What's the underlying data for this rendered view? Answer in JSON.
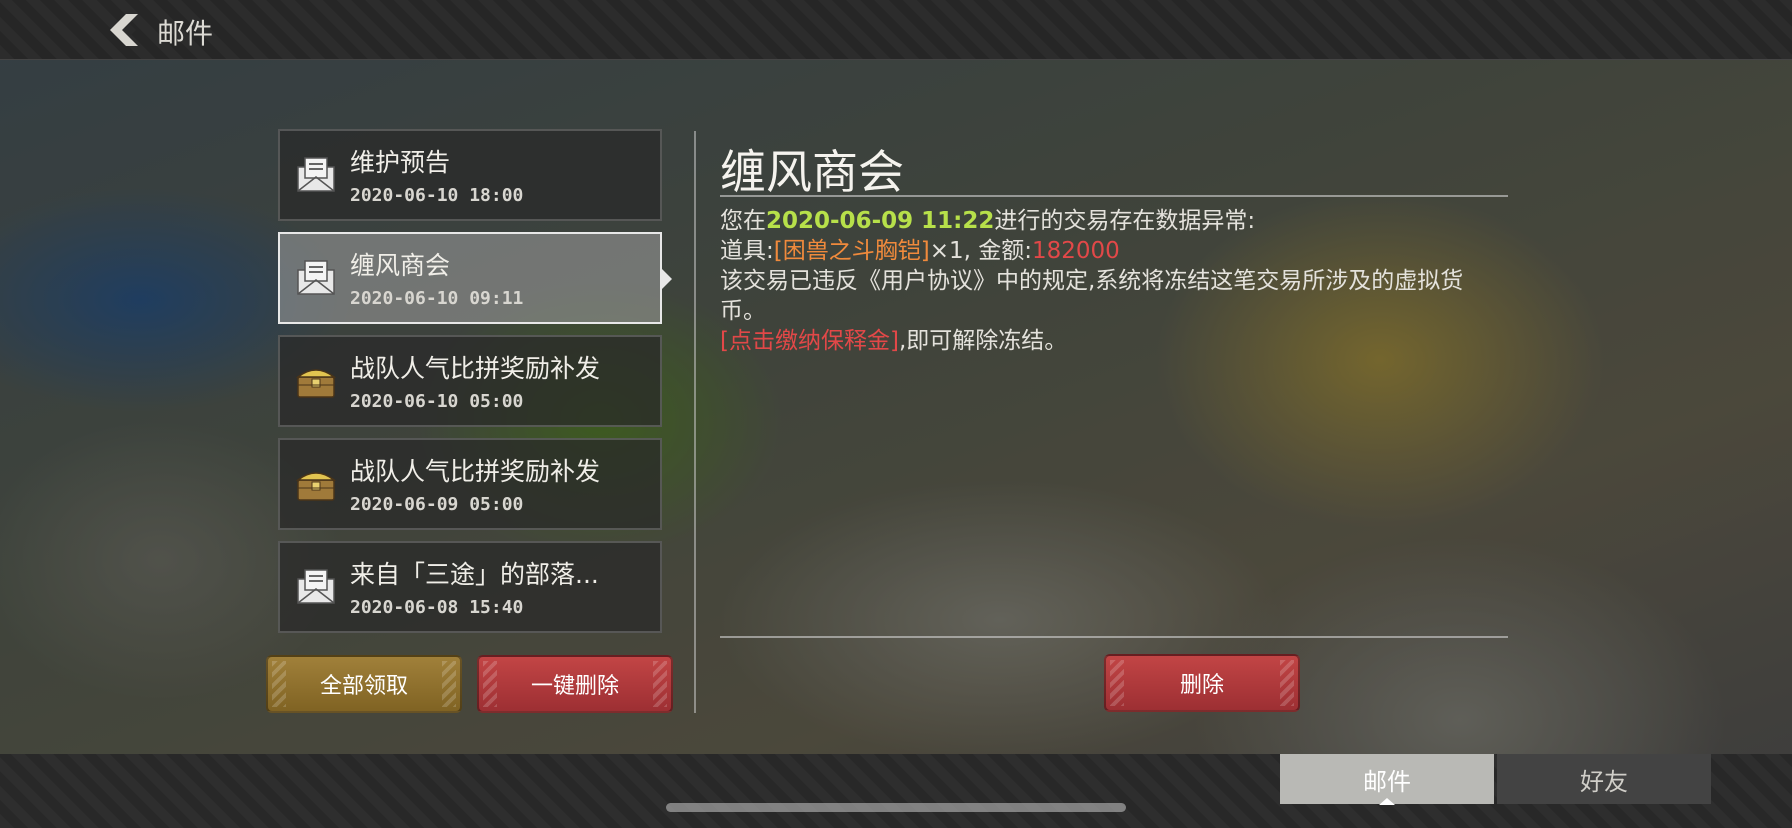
{
  "header": {
    "title": "邮件",
    "back_icon": "back-chevron-icon"
  },
  "mails": [
    {
      "title": "维护预告",
      "time": "2020-06-10  18:00",
      "icon": "envelope-icon",
      "selected": false
    },
    {
      "title": "缠风商会",
      "time": "2020-06-10  09:11",
      "icon": "envelope-icon",
      "selected": true
    },
    {
      "title": "战队人气比拼奖励补发",
      "time": "2020-06-10  05:00",
      "icon": "treasure-chest-icon",
      "selected": false
    },
    {
      "title": "战队人气比拼奖励补发",
      "time": "2020-06-09  05:00",
      "icon": "treasure-chest-icon",
      "selected": false
    },
    {
      "title": "来自「三途」的部落...",
      "time": "2020-06-08  15:40",
      "icon": "envelope-icon",
      "selected": false
    }
  ],
  "list_actions": {
    "claim_all": "全部领取",
    "delete_all": "一键删除"
  },
  "detail": {
    "title": "缠风商会",
    "line1_pre": "您在",
    "line1_time": "2020-06-09  11:22",
    "line1_post": "进行的交易存在数据异常:",
    "line2_label": "道具:",
    "line2_item": "[困兽之斗胸铠]",
    "line2_qty": "×1, 金额:",
    "line2_amount": "182000",
    "line3": "该交易已违反《用户协议》中的规定,系统将冻结这笔交易所涉及的虚拟货币。",
    "line4_link": "[点击缴纳保释金]",
    "line4_post": ",即可解除冻结。",
    "delete_label": "删除"
  },
  "tabs": {
    "mail": "邮件",
    "friends": "好友"
  },
  "colors": {
    "highlight_green": "#b7e04a",
    "highlight_orange": "#f08a3c",
    "highlight_red": "#e24848",
    "gold_button": "#a0803a",
    "red_button": "#c24545"
  }
}
